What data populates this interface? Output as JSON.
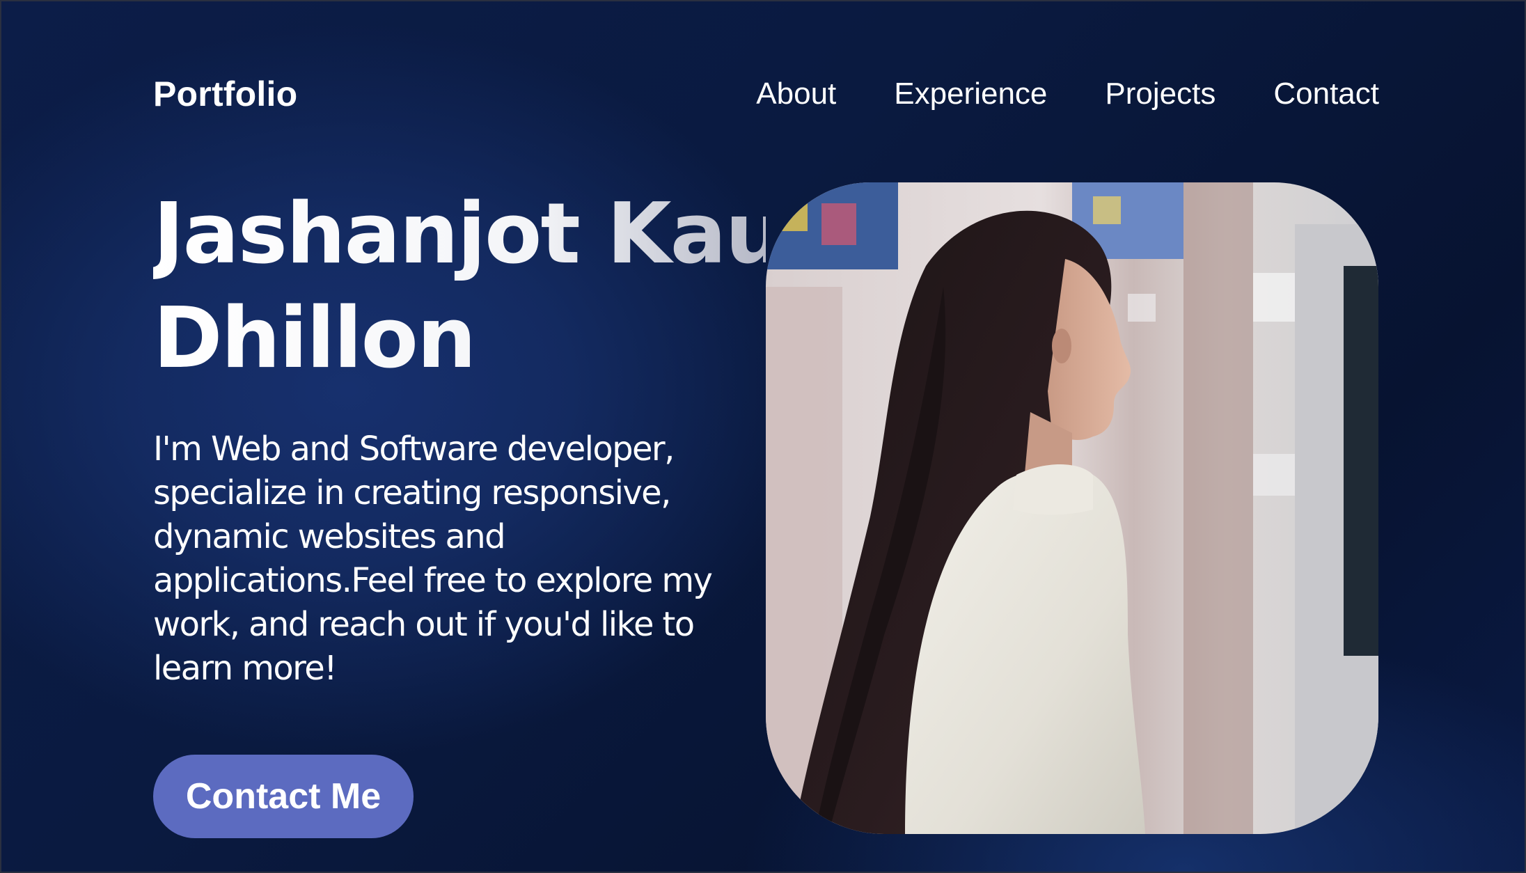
{
  "header": {
    "brand": "Portfolio",
    "nav": [
      {
        "label": "About"
      },
      {
        "label": "Experience"
      },
      {
        "label": "Projects"
      },
      {
        "label": "Contact"
      }
    ]
  },
  "hero": {
    "name_line1": "Jashanjot Kaur",
    "name_line2": "Dhillon",
    "bio": "I'm Web and Software developer, specialize in creating responsive, dynamic websites and applications.Feel free to explore my work, and reach out if you'd like to learn more!",
    "cta_label": "Contact Me"
  },
  "colors": {
    "background": "#0c1d48",
    "accent_button": "#5c6bc0",
    "text": "#ffffff"
  }
}
